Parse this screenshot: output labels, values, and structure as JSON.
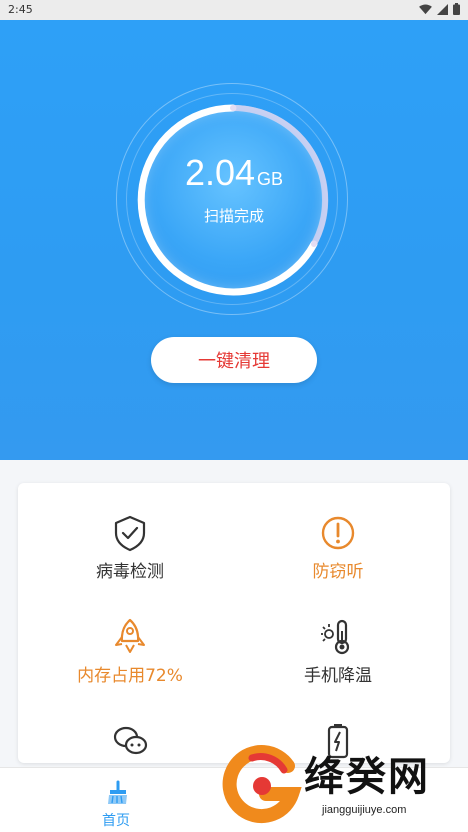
{
  "status_bar": {
    "time": "2:45"
  },
  "scan": {
    "size_value": "2.04",
    "size_unit": "GB",
    "status": "扫描完成"
  },
  "clean_button": {
    "label": "一键清理"
  },
  "features": [
    {
      "label": "病毒检测",
      "icon": "shield-check-icon"
    },
    {
      "label": "防窃听",
      "icon": "alert-circle-icon"
    },
    {
      "label": "内存占用72%",
      "icon": "rocket-icon"
    },
    {
      "label": "手机降温",
      "icon": "thermometer-icon"
    },
    {
      "label": "",
      "icon": "wechat-icon"
    },
    {
      "label": "",
      "icon": "battery-icon"
    }
  ],
  "bottom_nav": {
    "home_label": "首页"
  },
  "watermark": {
    "brand": "绛癸网",
    "url": "jiangguijiuye.com"
  },
  "colors": {
    "hero": "#2e9cf2",
    "accent_red": "#e53935",
    "accent_orange": "#e8892d"
  }
}
